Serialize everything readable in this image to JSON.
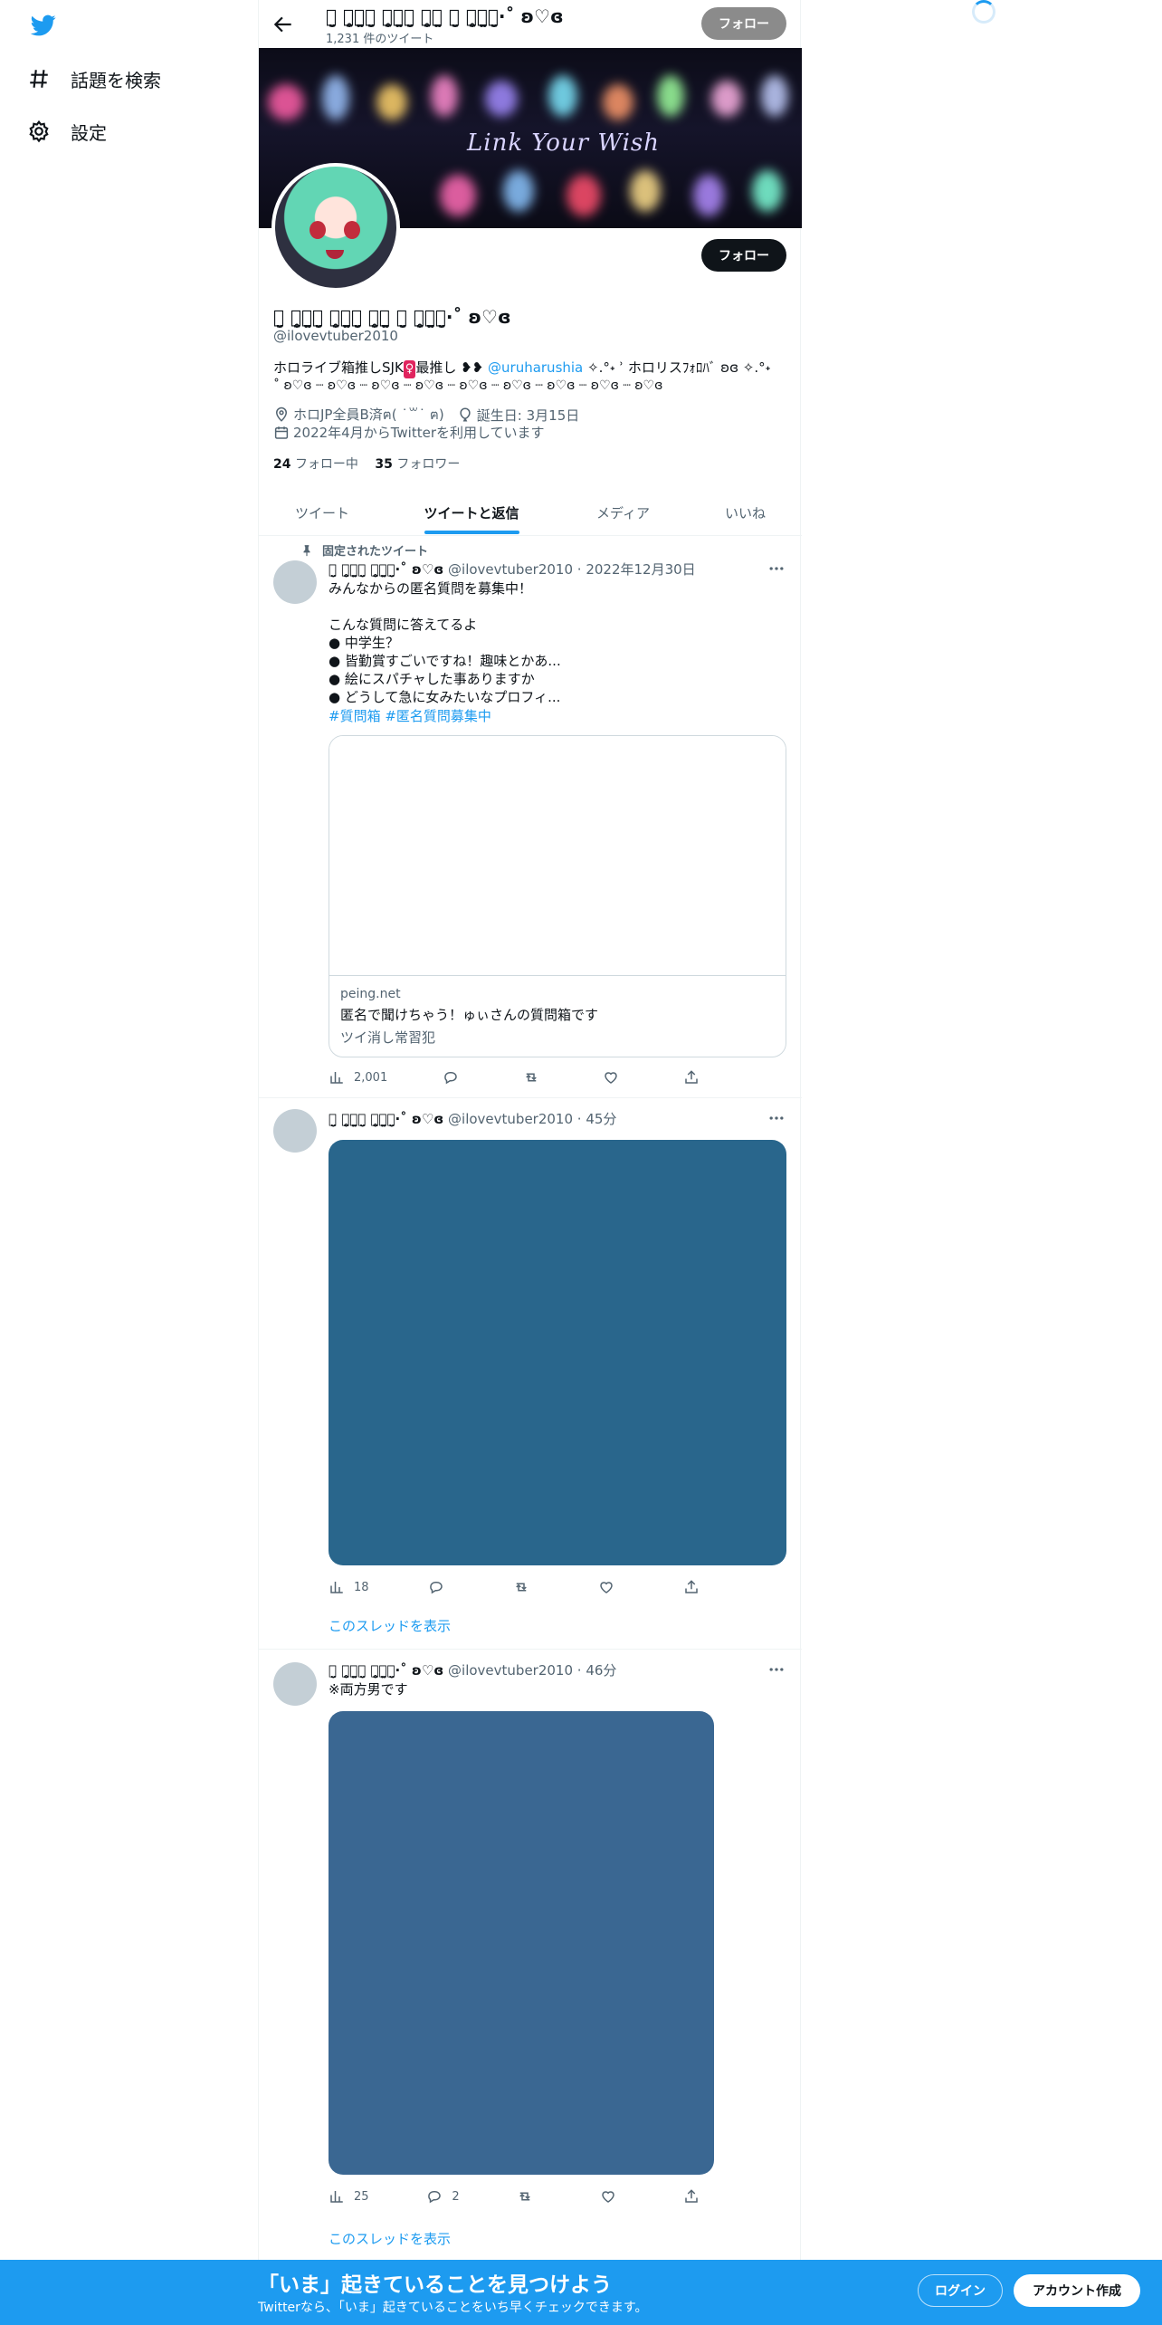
{
  "sidebar": {
    "items": [
      {
        "label": "話題を検索",
        "icon": "hashtag-icon"
      },
      {
        "label": "設定",
        "icon": "gear-icon"
      }
    ]
  },
  "header": {
    "name": "ꪔ̤̮ ꪔ̤̥ꪔ̤̫ꪔ̤̮ ꪔ̤̥ꪔ̤̫ꪔ̤̮ ꪔ̤̥ꪔ̤̫ ꪔ̤̮ ꪔ̤̥ꪔ̤̫ꪔ̤̮·˚ ʚ♡ɞ",
    "tweet_count": "1,231 件のツイート",
    "follow_label": "フォロー"
  },
  "banner": {
    "text": "Link Your Wish"
  },
  "profile": {
    "display_name": "ꪔ̤̮ ꪔ̤̥ꪔ̤̫ꪔ̤̮ ꪔ̤̥ꪔ̤̫ꪔ̤̮ ꪔ̤̥ꪔ̤̫ ꪔ̤̮ ꪔ̤̥ꪔ̤̫ꪔ̤̮·˚ ʚ♡ɞ",
    "handle": "@ilovevtuber2010",
    "follow_label": "フォロー",
    "bio_part1": "ホロライブ箱推しSJK",
    "bio_emoji": "♀",
    "bio_part2": "最推し ❥❥ ",
    "bio_mention": "@uruharushia",
    "bio_part3": " ✧.°˖ ʾ ホロリスﾌｫﾛﾊﾞ ʚɞ ✧.°˖",
    "bio_line2": "˚ ʚ♡ɞ ┈ ʚ♡ɞ ┈ ʚ♡ɞ ┈ ʚ♡ɞ ┈ ʚ♡ɞ ┈ ʚ♡ɞ ┈ ʚ♡ɞ ┈ ʚ♡ɞ ┈ ʚ♡ɞ",
    "location": "ホロJP全員B済ฅ( ˙꒳˙ ฅ)",
    "birthday": "誕生日: 3月15日",
    "joined": "2022年4月からTwitterを利用しています",
    "following_count": "24",
    "following_label": "フォロー中",
    "followers_count": "35",
    "followers_label": "フォロワー"
  },
  "tabs": [
    {
      "label": "ツイート"
    },
    {
      "label": "ツイートと返信"
    },
    {
      "label": "メディア"
    },
    {
      "label": "いいね"
    }
  ],
  "tweets": [
    {
      "pinned_label": "固定されたツイート",
      "name": "ꪔ̤̮ ꪔ̤̥ꪔ̤̫ꪔ̤̮ ꪔ̤̥ꪔ̤̫ꪔ̤̮·˚ ʚ♡ɞ",
      "meta": "@ilovevtuber2010 · 2022年12月30日",
      "text": "みんなからの匿名質問を募集中！\n\nこんな質問に答えてるよ\n● 中学生？\n● 皆勤賞すごいですね！趣味とかあ...\n● 絵にスパチャした事ありますか\n● どうして急に女みたいなプロフィ...",
      "hashtags": "#質問箱 #匿名質問募集中",
      "card_domain": "peing.net",
      "card_title": "匿名で聞けちゃう！ゅぃさんの質問箱です",
      "card_desc": "ツイ消し常習犯",
      "views": "2,001",
      "replies": "",
      "retweets": "",
      "likes": ""
    },
    {
      "name": "ꪔ̤̮ ꪔ̤̥ꪔ̤̫ꪔ̤̮ ꪔ̤̥ꪔ̤̫ꪔ̤̮·˚ ʚ♡ɞ",
      "meta": "@ilovevtuber2010 · 45分",
      "views": "18",
      "show_thread": "このスレッドを表示",
      "image_color": "#29668c"
    },
    {
      "name": "ꪔ̤̮ ꪔ̤̥ꪔ̤̫ꪔ̤̮ ꪔ̤̥ꪔ̤̫ꪔ̤̮·˚ ʚ♡ɞ",
      "meta": "@ilovevtuber2010 · 46分",
      "text": "※両方男です",
      "views": "25",
      "replies": "2",
      "show_thread": "このスレッドを表示",
      "image_color": "#3a6792"
    }
  ],
  "bottombar": {
    "title": "「いま」起きていることを見つけよう",
    "subtitle": "Twitterなら、「いま」起きていることをいち早くチェックできます。",
    "login_label": "ログイン",
    "signup_label": "アカウント作成"
  },
  "colors": {
    "accent": "#1d9bf0",
    "text": "#0f1419",
    "muted": "#536471"
  }
}
